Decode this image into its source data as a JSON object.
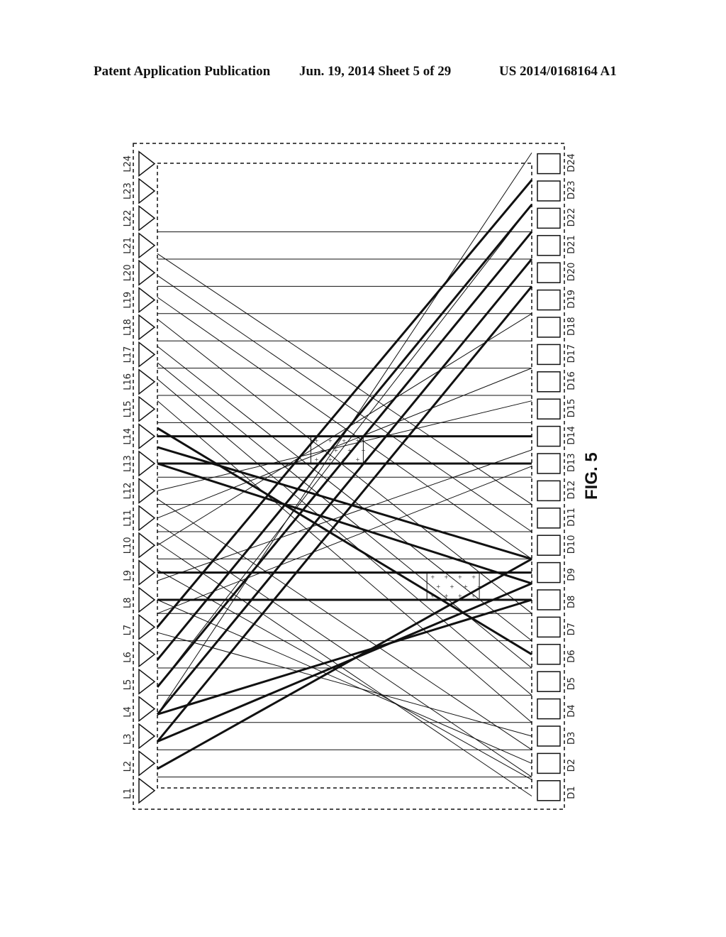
{
  "header": {
    "left": "Patent Application Publication",
    "center": "Jun. 19, 2014  Sheet 5 of 29",
    "right": "US 2014/0168164 A1"
  },
  "figure": {
    "caption": "FIG. 5",
    "left_labels": [
      "L1",
      "L2",
      "L3",
      "L4",
      "L5",
      "L6",
      "L7",
      "L8",
      "L9",
      "L10",
      "L11",
      "L12",
      "L13",
      "L14",
      "L15",
      "L16",
      "L17",
      "L18",
      "L19",
      "L20",
      "L21",
      "L22",
      "L23",
      "L24"
    ],
    "right_labels": [
      "D1",
      "D2",
      "D3",
      "D4",
      "D5",
      "D6",
      "D7",
      "D8",
      "D9",
      "D10",
      "D11",
      "D12",
      "D13",
      "D14",
      "D15",
      "D16",
      "D17",
      "D18",
      "D19",
      "D20",
      "D21",
      "D22",
      "D23",
      "D24"
    ],
    "segments_note": "each segment: [left_row, right_row, weight] in row units (row 0 = bottom edge of L1/D1)",
    "segments": [
      [
        1,
        1,
        "thin"
      ],
      [
        2,
        2,
        "thin"
      ],
      [
        3,
        3,
        "thin"
      ],
      [
        4,
        4,
        "thin"
      ],
      [
        5,
        5,
        "thin"
      ],
      [
        6,
        6,
        "thin"
      ],
      [
        7,
        7,
        "thin"
      ],
      [
        9,
        9,
        "thin"
      ],
      [
        10,
        10,
        "thin"
      ],
      [
        11,
        11,
        "thin"
      ],
      [
        12,
        12,
        "thin"
      ],
      [
        14,
        14,
        "thin"
      ],
      [
        15,
        15,
        "thin"
      ],
      [
        16,
        16,
        "thin"
      ],
      [
        17,
        17,
        "thin"
      ],
      [
        18,
        18,
        "thin"
      ],
      [
        19,
        19,
        "thin"
      ],
      [
        20,
        20,
        "thin"
      ],
      [
        21,
        21,
        "thin"
      ],
      [
        7.5,
        7.5,
        "thick"
      ],
      [
        8.5,
        8.5,
        "thick"
      ],
      [
        12.5,
        12.5,
        "thick"
      ],
      [
        13.5,
        13.5,
        "thick"
      ],
      [
        13.8,
        5.5,
        "thick"
      ],
      [
        13.1,
        9.0,
        "thick"
      ],
      [
        12.5,
        8.1,
        "thick"
      ],
      [
        1.3,
        9.0,
        "thick"
      ],
      [
        2.3,
        8.1,
        "thick"
      ],
      [
        3.3,
        7.5,
        "thick"
      ],
      [
        2.3,
        19.0,
        "thick"
      ],
      [
        3.3,
        20.0,
        "thick"
      ],
      [
        4.3,
        21.0,
        "thick"
      ],
      [
        5.3,
        22.0,
        "thick"
      ],
      [
        6.5,
        22.9,
        "thick"
      ],
      [
        3.3,
        23.9,
        "thin"
      ],
      [
        4.3,
        22.0,
        "thin"
      ],
      [
        20.2,
        11.0,
        "thin"
      ],
      [
        19.4,
        10.0,
        "thin"
      ],
      [
        18.6,
        9.0,
        "thin"
      ],
      [
        17.8,
        7.0,
        "thin"
      ],
      [
        16.8,
        6.0,
        "thin"
      ],
      [
        16.2,
        5.0,
        "thin"
      ],
      [
        15.6,
        4.0,
        "thin"
      ],
      [
        14.8,
        3.0,
        "thin"
      ],
      [
        11.2,
        2.0,
        "thin"
      ],
      [
        10.3,
        1.0,
        "thin"
      ],
      [
        9.6,
        0.3,
        "thin"
      ],
      [
        8.6,
        0.9,
        "thin"
      ],
      [
        7.5,
        1.5,
        "thin"
      ],
      [
        6.3,
        2.5,
        "thin"
      ],
      [
        11.5,
        14.8,
        "thin"
      ],
      [
        10.5,
        16.0,
        "thin"
      ],
      [
        9.5,
        18.0,
        "thin"
      ],
      [
        8.2,
        13.0,
        "thin"
      ],
      [
        7.0,
        12.4,
        "thin"
      ]
    ],
    "hatched_regions": [
      {
        "rows": [
          12.5,
          13.5
        ],
        "span": [
          0.41,
          0.55
        ]
      },
      {
        "rows": [
          7.5,
          8.5
        ],
        "span": [
          0.72,
          0.86
        ]
      }
    ]
  }
}
